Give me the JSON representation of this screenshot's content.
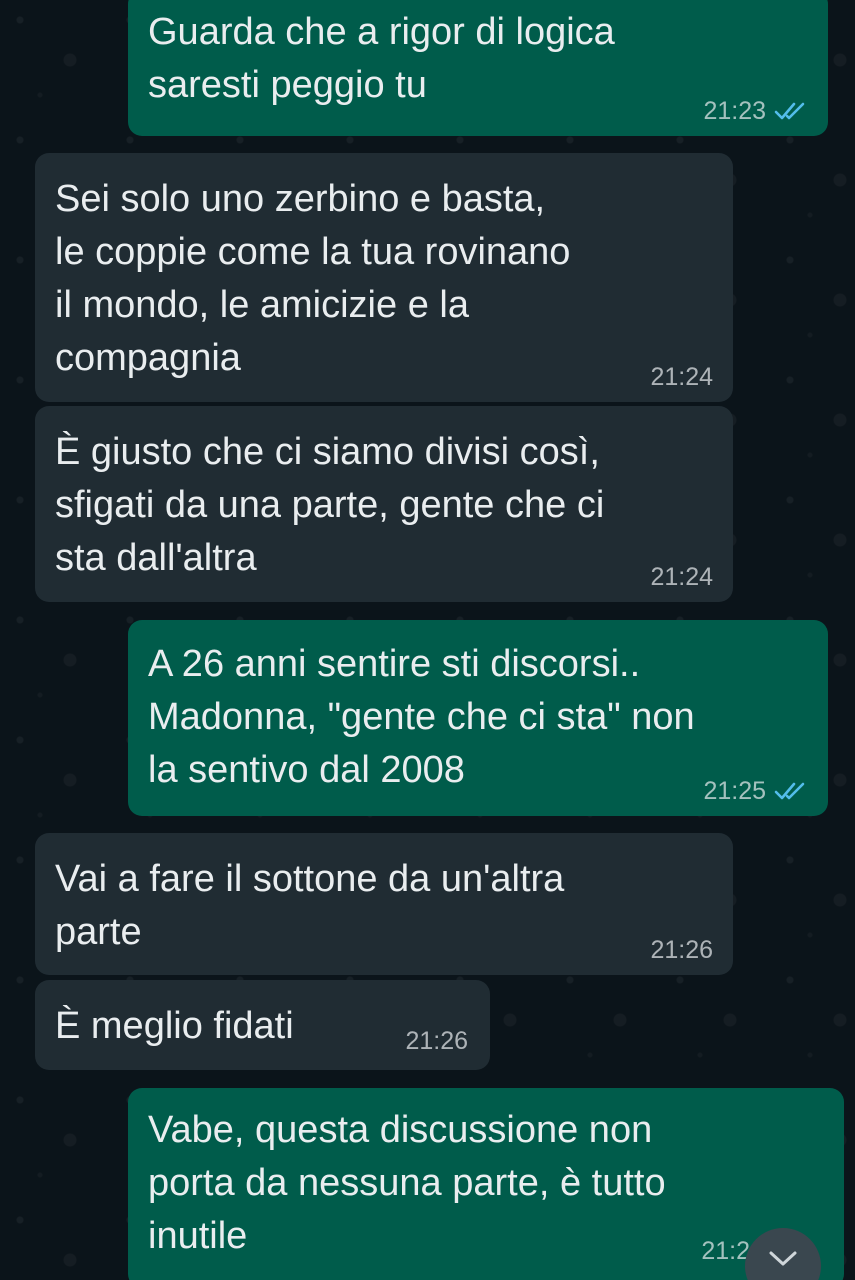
{
  "colors": {
    "background": "#0b141a",
    "incoming_bubble": "#202c33",
    "outgoing_bubble": "#005c4b",
    "read_ticks": "#53bdeb",
    "text": "#e9edef"
  },
  "messages": [
    {
      "direction": "outgoing",
      "text": "Guarda che a rigor di logica\nsaresti peggio tu",
      "time": "21:23",
      "status": "read"
    },
    {
      "direction": "incoming",
      "text": "Sei solo uno zerbino e basta,\nle coppie come la tua rovinano\nil mondo, le amicizie e la\ncompagnia",
      "time": "21:24"
    },
    {
      "direction": "incoming",
      "text": "È giusto che ci siamo divisi così,\nsfigati da una parte, gente che ci\nsta dall'altra",
      "time": "21:24"
    },
    {
      "direction": "outgoing",
      "text": "A 26 anni sentire sti discorsi..\nMadonna, \"gente che ci sta\" non\nla sentivo dal 2008",
      "time": "21:25",
      "status": "read"
    },
    {
      "direction": "incoming",
      "text": "Vai a fare il sottone da un'altra\nparte",
      "time": "21:26"
    },
    {
      "direction": "incoming",
      "text": "È meglio fidati",
      "time": "21:26"
    },
    {
      "direction": "outgoing",
      "text": "Vabe, questa discussione non\nporta da nessuna parte, è tutto\ninutile",
      "time": "21:2"
    }
  ],
  "icons": {
    "read_receipt": "double-check-icon",
    "scroll_down": "chevron-down-icon"
  }
}
